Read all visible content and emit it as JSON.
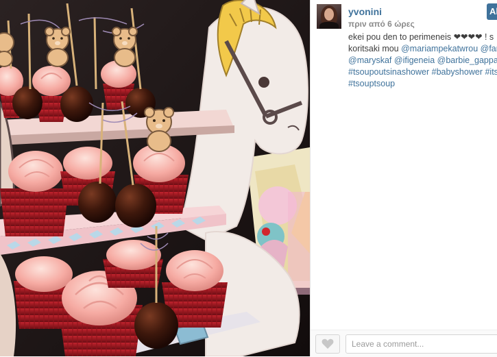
{
  "post": {
    "username": "yvonini",
    "timestamp": "πριν από 6 ώρες",
    "follow_label": "Ak",
    "caption": {
      "line1": "ekei pou den to perimeneis ❤❤❤❤ ! s",
      "line2_text": "koritsaki mou ",
      "line2_mentions": [
        "@mariampekatwrou",
        "@fanta"
      ],
      "line3_mentions": [
        "@maryskaf",
        "@ifigeneia",
        "@barbie_gappa"
      ],
      "line4_tags": [
        "#tsoupoutsinashower",
        "#babyshower",
        "#itsg"
      ],
      "line5_tags": [
        "#tsouptsoup"
      ]
    }
  },
  "comment": {
    "placeholder": "Leave a comment..."
  },
  "icons": {
    "like": "heart-icon"
  },
  "colors": {
    "link": "#3f729b",
    "frosting": "#f4a6a0",
    "cupcake_liner": "#b0202a"
  }
}
